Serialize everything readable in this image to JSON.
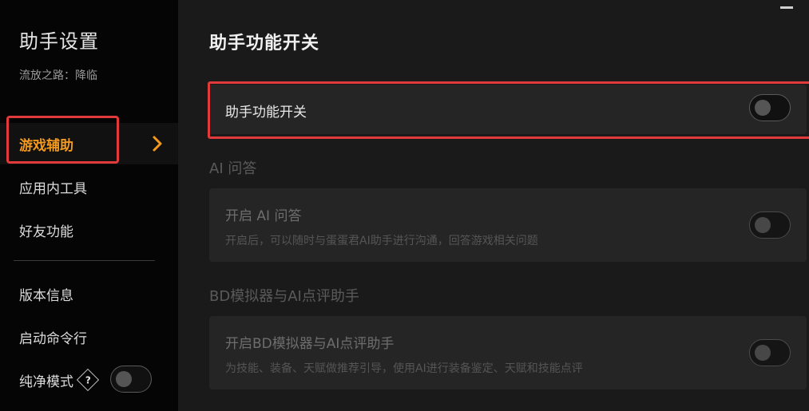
{
  "sidebar": {
    "title": "助手设置",
    "subtitle": "流放之路：降临",
    "nav": [
      {
        "label": "游戏辅助",
        "active": true
      },
      {
        "label": "应用内工具"
      },
      {
        "label": "好友功能"
      },
      {
        "label": "版本信息"
      },
      {
        "label": "启动命令行"
      },
      {
        "label": "纯净模式"
      }
    ],
    "help_glyph": "?"
  },
  "main": {
    "title": "助手功能开关",
    "master_toggle": {
      "label": "助手功能开关",
      "on": false
    },
    "sections": [
      {
        "title": "AI 问答",
        "card": {
          "label": "开启 AI 问答",
          "desc": "开启后，可以随时与蛋蛋君AI助手进行沟通，回答游戏相关问题",
          "on": false
        }
      },
      {
        "title": "BD模拟器与AI点评助手",
        "card": {
          "label": "开启BD模拟器与AI点评助手",
          "desc": "为技能、装备、天赋做推荐引导，使用AI进行装备鉴定、天赋和技能点评",
          "on": false
        }
      }
    ]
  },
  "colors": {
    "accent": "#f39a1e",
    "highlight": "#e03a3a",
    "sidebar_bg": "#050505",
    "main_bg": "#1a1a1a",
    "card_bg": "#252525"
  },
  "icons": {
    "nav_chevron": "chevron-right-icon",
    "minimize": "minimize-icon",
    "help": "help-diamond-icon"
  }
}
